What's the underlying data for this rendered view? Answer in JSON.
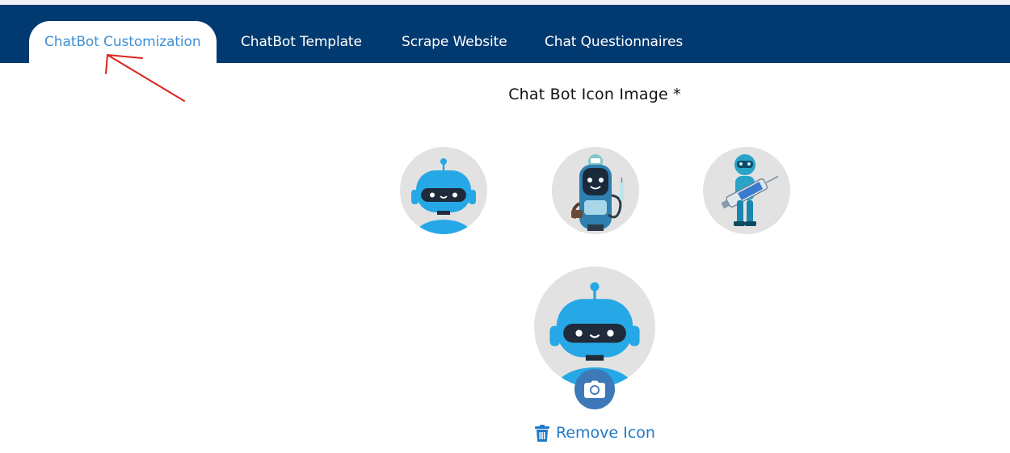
{
  "tabs": [
    {
      "label": "ChatBot Customization",
      "active": true
    },
    {
      "label": "ChatBot Template",
      "active": false
    },
    {
      "label": "Scrape Website",
      "active": false
    },
    {
      "label": "Chat Questionnaires",
      "active": false
    }
  ],
  "section": {
    "title": "Chat Bot Icon Image *"
  },
  "icon_choices": [
    {
      "icon": "robot-head-icon"
    },
    {
      "icon": "medical-robot-icon"
    },
    {
      "icon": "syringe-robot-icon"
    }
  ],
  "preview": {
    "icon": "robot-head-icon",
    "upload_icon": "camera-icon"
  },
  "remove": {
    "label": "Remove Icon",
    "icon": "trash-icon"
  },
  "colors": {
    "navbar": "#003a70",
    "active_tab_text": "#3f8fd6",
    "link": "#1f78c8",
    "robot_blue": "#27a8e6",
    "circle_bg": "#e2e2e2",
    "annotation_arrow": "#d9241c"
  }
}
